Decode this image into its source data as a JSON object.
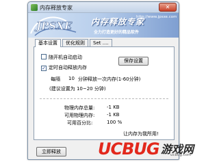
{
  "window": {
    "title": "内存释放专家",
    "close_glyph": "✕"
  },
  "banner": {
    "title": "内存释放专家",
    "url": "http://www.jpsxe.com",
    "slogan": "全力打造更好的精品软件",
    "logo_text": "JPSXE"
  },
  "tabs": [
    {
      "label": "基本设置",
      "active": true
    },
    {
      "label": "优化规则",
      "active": false
    },
    {
      "label": "Set ....",
      "active": false
    }
  ],
  "settings": {
    "autostart_label": "随开机自动启动",
    "autostart_checked": false,
    "timed_release_label": "定时自动释放内存",
    "timed_release_checked": true,
    "save_button": "保存设置",
    "interval_prefix": "每隔",
    "interval_value": "10",
    "interval_suffix": "分钟释放一次内存(1-60分钟)",
    "recommendation": "(建议设置为 10~20 分钟)"
  },
  "memory": {
    "total_label": "物理内存总量:",
    "total_value": "-1 KB",
    "available_label": "可用物理内存:",
    "available_value": "-1 KB",
    "percent_label": "可用百分比:",
    "percent_value": "100 %",
    "slogan": "让内存为我所用!"
  },
  "footer": {
    "release_button": "立即释放"
  },
  "watermark": {
    "brand": "UCBUG",
    "cn": "游戏网",
    "url": "ucbug.com"
  }
}
